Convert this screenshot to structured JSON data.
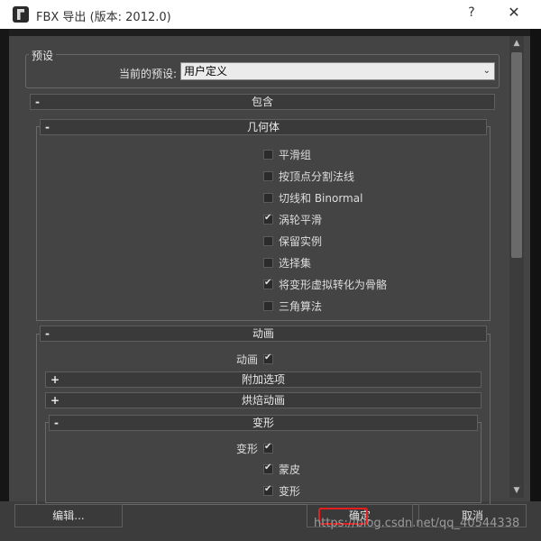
{
  "window": {
    "title": "FBX 导出 (版本: 2012.0)",
    "help_label": "?",
    "close_label": "✕"
  },
  "preset": {
    "group_title": "预设",
    "current_label": "当前的预设:",
    "current_value": "用户定义"
  },
  "rollouts": {
    "include": {
      "sign": "-",
      "title": "包含"
    },
    "geometry": {
      "sign": "-",
      "title": "几何体"
    },
    "animation": {
      "sign": "-",
      "title": "动画"
    },
    "extra_options": {
      "sign": "+",
      "title": "附加选项"
    },
    "bake_animation": {
      "sign": "+",
      "title": "烘焙动画"
    },
    "deformations": {
      "sign": "-",
      "title": "变形"
    }
  },
  "geometry_options": [
    {
      "label": "平滑组",
      "checked": false
    },
    {
      "label": "按顶点分割法线",
      "checked": false
    },
    {
      "label": "切线和 Binormal",
      "checked": false
    },
    {
      "label": "涡轮平滑",
      "checked": true
    },
    {
      "label": "保留实例",
      "checked": false
    },
    {
      "label": "选择集",
      "checked": false
    },
    {
      "label": "将变形虚拟转化为骨骼",
      "checked": true
    },
    {
      "label": "三角算法",
      "checked": false
    }
  ],
  "animation_toggle": {
    "label": "动画",
    "checked": true
  },
  "deformations_toggle": {
    "label": "变形",
    "checked": true
  },
  "deformation_options": [
    {
      "label": "蒙皮",
      "checked": true
    },
    {
      "label": "变形",
      "checked": true
    }
  ],
  "buttons": {
    "edit": "编辑...",
    "ok": "确定",
    "cancel": "取消"
  },
  "watermark": "https://blog.csdn.net/qq_40544338"
}
